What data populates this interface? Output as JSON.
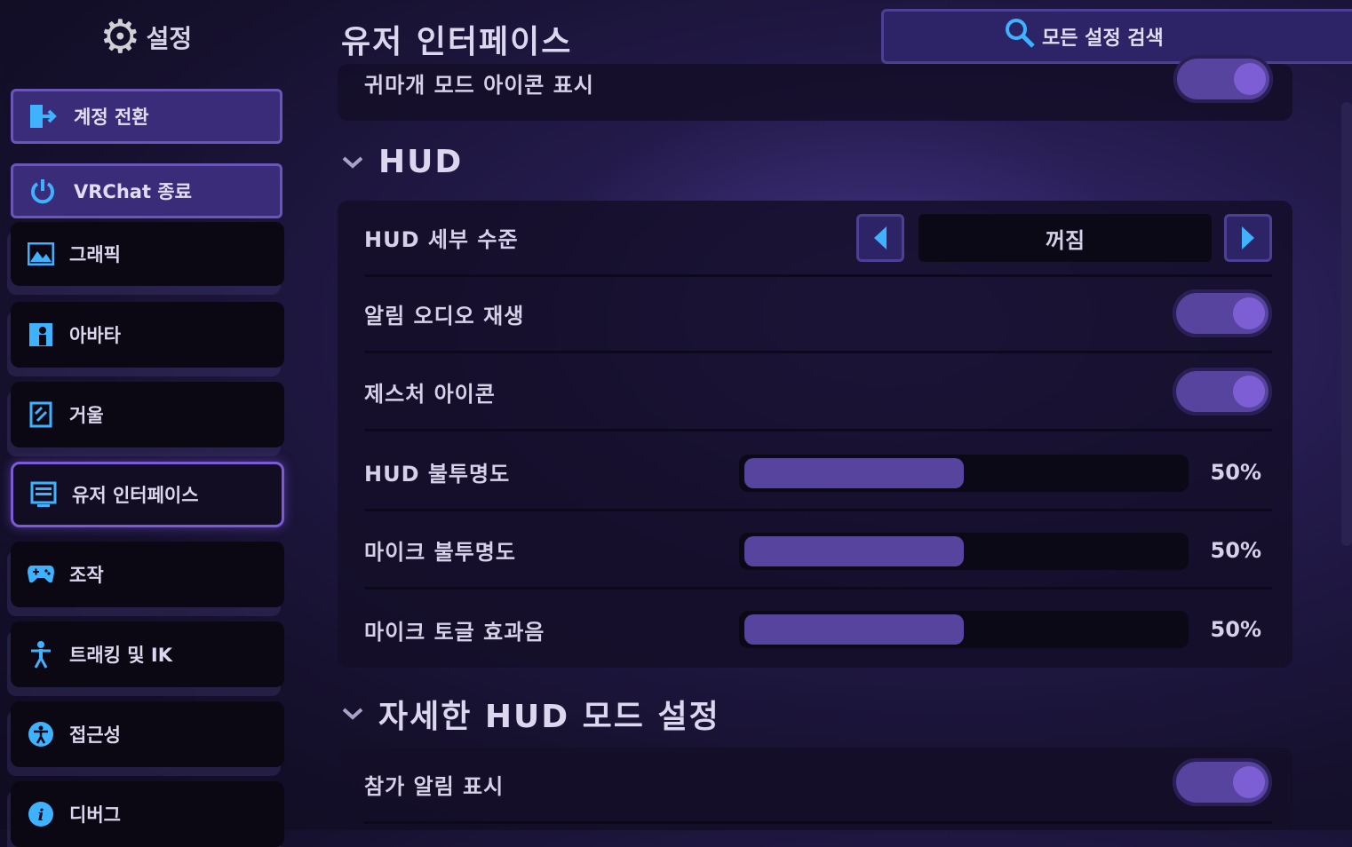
{
  "app": {
    "sidebar_title": "설정",
    "page_title": "유저 인터페이스",
    "search_label": "모든 설정 검색"
  },
  "sidebar": {
    "top_buttons": [
      {
        "label": "계정 전환",
        "icon": "switch-account-icon"
      },
      {
        "label": "VRChat 종료",
        "icon": "power-icon"
      }
    ],
    "items": [
      {
        "label": "그래픽",
        "icon": "graphics-icon"
      },
      {
        "label": "아바타",
        "icon": "avatar-icon"
      },
      {
        "label": "거울",
        "icon": "mirror-icon"
      },
      {
        "label": "유저 인터페이스",
        "icon": "ui-icon",
        "active": true
      },
      {
        "label": "조작",
        "icon": "gamepad-icon"
      },
      {
        "label": "트래킹 및 IK",
        "icon": "tracking-icon"
      },
      {
        "label": "접근성",
        "icon": "accessibility-icon"
      },
      {
        "label": "디버그",
        "icon": "info-icon"
      }
    ]
  },
  "main": {
    "top_row": {
      "label": "귀마개 모드 아이콘 표시",
      "toggle_on": true
    },
    "hud_section": {
      "title": "HUD",
      "detail": {
        "label": "HUD 세부 수준",
        "value": "꺼짐"
      },
      "toggles": [
        {
          "label": "알림 오디오 재생",
          "on": true
        },
        {
          "label": "제스처 아이콘",
          "on": true
        }
      ],
      "sliders": [
        {
          "label": "HUD 불투명도",
          "value_text": "50%",
          "value": 0.5
        },
        {
          "label": "마이크 불투명도",
          "value_text": "50%",
          "value": 0.5
        },
        {
          "label": "마이크 토글 효과음",
          "value_text": "50%",
          "value": 0.5
        }
      ]
    },
    "detail_hud_section": {
      "title": "자세한 HUD 모드 설정",
      "rows": [
        {
          "label": "참가 알림 표시",
          "on": true
        }
      ]
    }
  },
  "colors": {
    "accent": "#3fb2ff",
    "toggle_on": "#57449e",
    "knob": "#7e5ed4",
    "active_border": "#7b5ad6"
  }
}
